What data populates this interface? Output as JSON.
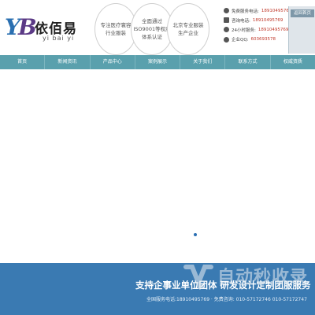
{
  "brand": {
    "logo_mark": "YB",
    "name": "依佰易",
    "pinyin": "yi bai yi"
  },
  "badges": [
    {
      "line1": "专注医疗寰容",
      "line2": "行业服装"
    },
    {
      "line1": "全面通过",
      "line2": "ISO9001等权威",
      "line3": "体系认证"
    },
    {
      "line1": "北京专业服装",
      "line2": "生产企业"
    }
  ],
  "contacts": [
    {
      "icon": "user-icon",
      "label": "免费服务电话:",
      "value": "18910495769"
    },
    {
      "icon": "phone-icon",
      "label": "咨询电话:",
      "value": "18910495769"
    },
    {
      "icon": "clock-icon",
      "label": "24小时服务:",
      "value": "18910495769"
    },
    {
      "icon": "qq-icon",
      "label": "企业QQ:",
      "value": "603693578"
    }
  ],
  "sidepanel": {
    "back_home": "返回首页"
  },
  "nav": [
    "首页",
    "新闻资讯",
    "产品中心",
    "案例展示",
    "关于我们",
    "联系方式",
    "权威资质"
  ],
  "banner": {
    "active_slide": 1
  },
  "footer": {
    "title": "支持企事业单位团体 研发设计定制团服服务",
    "contact": "全国服务电话:18910495769 · 免费咨询: 010-57172746 010-57172747"
  },
  "watermark": {
    "text": "自动秒收录"
  },
  "colors": {
    "nav": "#5aa0ad",
    "footer": "#3a7ab2",
    "accent": "#2b6fb3"
  }
}
